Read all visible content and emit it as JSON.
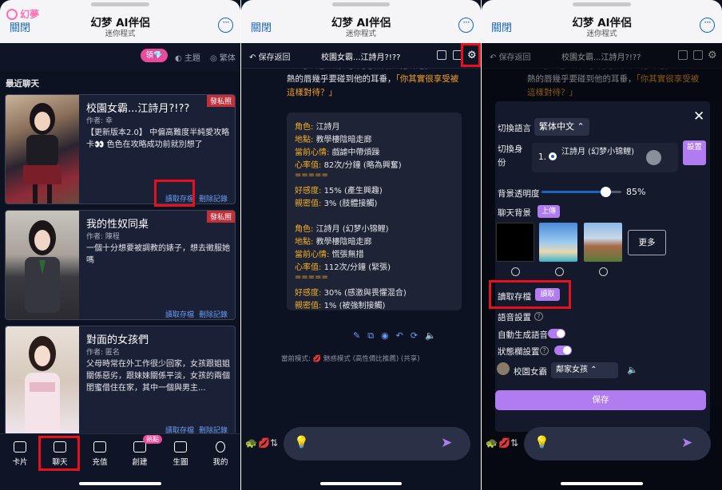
{
  "wechat": {
    "close": "關閉",
    "title": "幻梦 AI伴侶",
    "subtitle": "迷你程式",
    "more": "···"
  },
  "panel1": {
    "logo": "幻夢",
    "claim": "領💎",
    "theme": "◐ 主題",
    "lang": "◎ 繁体",
    "recent_label": "最近聊天",
    "cards": [
      {
        "title": "校園女霸...江詩月?!??",
        "author": "作者: 幸",
        "desc": "【更新版本2.0】 中偏高難度半純愛攻略卡👀 色色在攻略成功前就別想了",
        "tag": "發私照",
        "load": "讀取存檔",
        "delete": "刪除記錄"
      },
      {
        "title": "我的性奴同桌",
        "author": "作者: 陳程",
        "desc": "一個十分想要被調教的婊子，想去徵服她嗎",
        "tag": "發私照",
        "load": "讀取存檔",
        "delete": "刪除記錄"
      },
      {
        "title": "對面的女孩們",
        "author": "作者: 匿名",
        "desc": "父母時常在外工作很少回家，女孩跟姐姐關係惡劣，跟妹妹關係平淡，女孩的兩個閨蜜借住在家，其中一個與男主...",
        "tag": "",
        "load": "讀取存檔",
        "delete": "刪除記錄"
      }
    ],
    "nav": [
      {
        "label": "卡片",
        "icon": "home-icon"
      },
      {
        "label": "聊天",
        "icon": "chat-icon"
      },
      {
        "label": "充值",
        "icon": "card-icon"
      },
      {
        "label": "創建",
        "icon": "edit-icon"
      },
      {
        "label": "生圖",
        "icon": "image-icon"
      },
      {
        "label": "我的",
        "icon": "user-icon"
      }
    ],
    "hot_badge": "熱點"
  },
  "panel2": {
    "back": "保存返回",
    "chat_title": "校園女霸...江詩月?!??",
    "text_plain": "熱的唇幾乎要碰到他的耳垂，",
    "text_orange": "「你其實很享受被這樣對待？」",
    "text_top": "「壹」「還是說...」她忽然貼近他耳邊，溫",
    "stats": [
      {
        "k": "角色:",
        "v": "江詩月"
      },
      {
        "k": "地點:",
        "v": "教學樓陰暗走廊"
      },
      {
        "k": "當前心情:",
        "v": "戲謔中帶煩躁"
      },
      {
        "k": "心率值:",
        "v": "82次/分鐘 (略為興奮)"
      },
      {
        "k": "=====",
        "v": ""
      },
      {
        "k": "好感度:",
        "v": "15% (產生興趣)"
      },
      {
        "k": "親密值:",
        "v": "3% (肢體接觸)"
      },
      {
        "k": "",
        "v": ""
      },
      {
        "k": "角色:",
        "v": "江詩月 (幻梦小锦鲤)"
      },
      {
        "k": "地點:",
        "v": "教學樓陰暗走廊"
      },
      {
        "k": "當前心情:",
        "v": "慌張無措"
      },
      {
        "k": "心率值:",
        "v": "112次/分鐘 (緊張)"
      },
      {
        "k": "=====",
        "v": ""
      },
      {
        "k": "好感度:",
        "v": "30% (感激與畏懼混合)"
      },
      {
        "k": "親密值:",
        "v": "1% (被強制接觸)"
      }
    ],
    "mode_prefix": "當前模式:",
    "mode": "魅惑模式 (高性價比推薦) (共享)"
  },
  "panel3": {
    "back": "保存返回",
    "chat_title": "校園女霸...江詩月?!??",
    "text_top": "「壹」「還是說...」她忽然貼近他耳邊，溫",
    "text_plain": "熱的唇幾乎要碰到他的耳垂，",
    "text_orange": "「你其實很享受被這樣對待？」",
    "lang_label": "切換語言",
    "lang_value": "繁体中文",
    "identity_label": "切換身份",
    "role_index": "1.",
    "role_name": "江詩月 (幻梦小锦鲤)",
    "setting_btn": "設置",
    "opacity_label": "背景透明度",
    "opacity_value": 85,
    "opacity_text": "85%",
    "bg_label": "聊天背景",
    "upload_btn": "上傳",
    "more_btn": "更多",
    "read_label": "讀取存檔",
    "read_btn": "讀取",
    "voice_label": "語音設置",
    "auto_voice_label": "自動生成語音",
    "status_label": "狀態欄設置",
    "voice_char": "校園女霸",
    "voice_select": "鄰家女孩",
    "save_btn": "保存"
  },
  "colors": {
    "bg": "#0d1222",
    "accent": "#b07cf0",
    "pink": "#e84a9c",
    "highlight": "#e8101c",
    "orange": "#f5a028"
  }
}
